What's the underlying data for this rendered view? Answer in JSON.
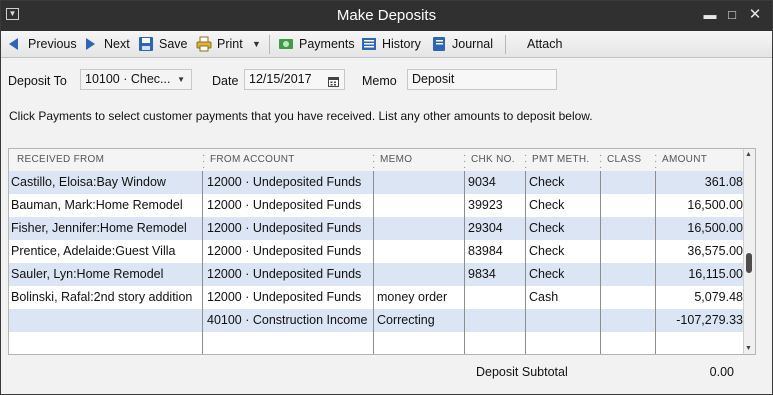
{
  "window": {
    "title": "Make Deposits"
  },
  "toolbar": {
    "previous": "Previous",
    "next": "Next",
    "save": "Save",
    "print": "Print",
    "payments": "Payments",
    "history": "History",
    "journal": "Journal",
    "attach": "Attach"
  },
  "form": {
    "deposit_to_label": "Deposit To",
    "deposit_to_value": "10100 · Chec...",
    "date_label": "Date",
    "date_value": "12/15/2017",
    "memo_label": "Memo",
    "memo_value": "Deposit"
  },
  "instructions": "Click Payments to select customer payments that you have received. List any other amounts to deposit below.",
  "table": {
    "headers": [
      "RECEIVED FROM",
      "FROM ACCOUNT",
      "MEMO",
      "CHK NO.",
      "PMT METH.",
      "CLASS",
      "AMOUNT"
    ],
    "rows": [
      [
        "Castillo, Eloisa:Bay Window",
        "12000 · Undeposited Funds",
        "",
        "9034",
        "Check",
        "",
        "361.08"
      ],
      [
        "Bauman, Mark:Home Remodel",
        "12000 · Undeposited Funds",
        "",
        "39923",
        "Check",
        "",
        "16,500.00"
      ],
      [
        "Fisher, Jennifer:Home Remodel",
        "12000 · Undeposited Funds",
        "",
        "29304",
        "Check",
        "",
        "16,500.00"
      ],
      [
        "Prentice, Adelaide:Guest Villa",
        "12000 · Undeposited Funds",
        "",
        "83984",
        "Check",
        "",
        "36,575.00"
      ],
      [
        "Sauler, Lyn:Home Remodel",
        "12000 · Undeposited Funds",
        "",
        "9834",
        "Check",
        "",
        "16,115.00"
      ],
      [
        "Bolinski, Rafal:2nd story addition",
        "12000 · Undeposited Funds",
        "money order",
        "",
        "Cash",
        "",
        "5,079.48"
      ],
      [
        "",
        "40100 · Construction Income",
        "Correcting",
        "",
        "",
        "",
        "-107,279.33"
      ]
    ]
  },
  "footer": {
    "subtotal_label": "Deposit Subtotal",
    "subtotal_value": "0.00"
  },
  "colors": {
    "title_bar": "#303030",
    "row_alt": "#dbe5f4",
    "nav_arrow": "#2f66b3"
  }
}
